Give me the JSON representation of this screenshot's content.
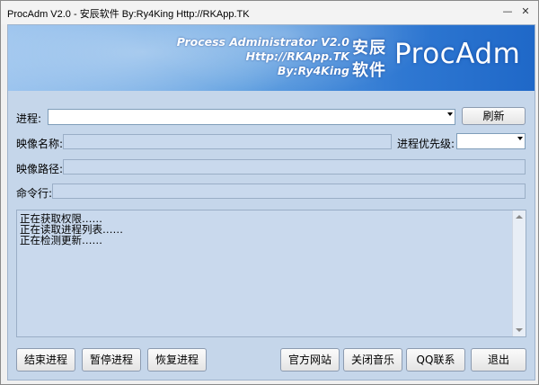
{
  "window": {
    "title": "ProcAdm V2.0 - 安辰软件   By:Ry4King   Http://RKApp.TK",
    "minimize_glyph": "—",
    "close_glyph": "✕"
  },
  "banner": {
    "line1": "Process Administrator V2.0",
    "line2": "Http://RKApp.TK",
    "line3": "By:Ry4King",
    "cn_line1": "安辰",
    "cn_line2": "软件",
    "logo": "ProcAdm"
  },
  "form": {
    "process_label": "进程:",
    "process_value": "",
    "refresh_label": "刷新",
    "image_name_label": "映像名称:",
    "image_name_value": "",
    "priority_label": "进程优先级:",
    "priority_value": "",
    "image_path_label": "映像路径:",
    "image_path_value": "",
    "cmdline_label": "命令行:",
    "cmdline_value": ""
  },
  "log": {
    "lines": [
      "正在获取权限……",
      "正在读取进程列表……",
      "正在检测更新……"
    ]
  },
  "buttons": {
    "end_process": "结束进程",
    "pause_process": "暂停进程",
    "resume_process": "恢复进程",
    "official_site": "官方网站",
    "close_music": "关闭音乐",
    "qq_contact": "QQ联系",
    "exit": "退出"
  },
  "colors": {
    "client_bg": "#c5d6ea",
    "banner_start": "#9cc4ee",
    "banner_end": "#1f68c8"
  }
}
